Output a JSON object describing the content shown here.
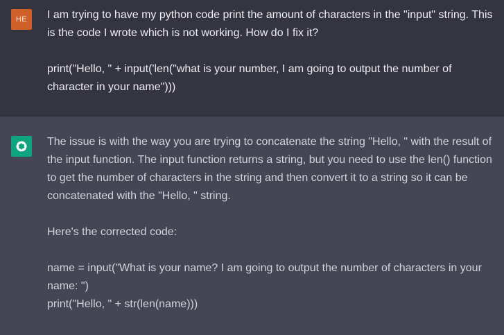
{
  "user": {
    "avatar_initials": "HE",
    "avatar_color": "#d0602a",
    "message_paragraph_1": "I am trying to have my python code print the amount of characters in the \"input\" string. This is the code I wrote which is not working. How do I fix it?",
    "message_paragraph_2": "print(\"Hello, \" + input('len(\"what is your number, I am going to output the number of character in your name\")))"
  },
  "assistant": {
    "avatar_icon": "openai-logo-icon",
    "avatar_color": "#10a37f",
    "paragraph_1": "The issue is with the way you are trying to concatenate the string \"Hello, \" with the result of the input function. The input function returns a string, but you need to use the len() function to get the number of characters in the string and then convert it to a string so it can be concatenated with the \"Hello, \" string.",
    "paragraph_2": "Here's the corrected code:",
    "code_line_1": "name = input(\"What is your name? I am going to output the number of characters in your name: \")",
    "code_line_2": "print(\"Hello, \" + str(len(name)))"
  }
}
